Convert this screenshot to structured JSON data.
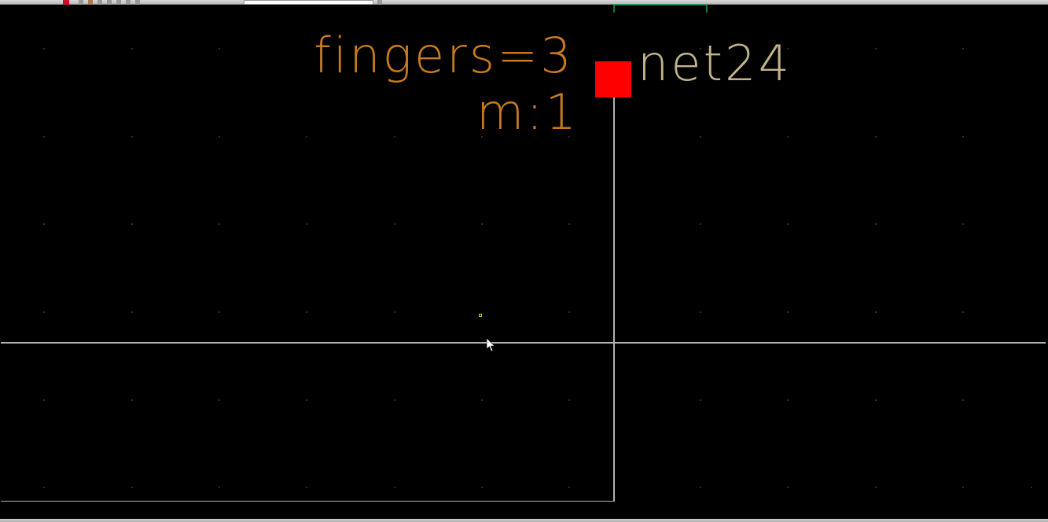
{
  "schematic": {
    "param_fingers": "fingers=3",
    "param_m": "m:1",
    "net_label": "net24"
  }
}
